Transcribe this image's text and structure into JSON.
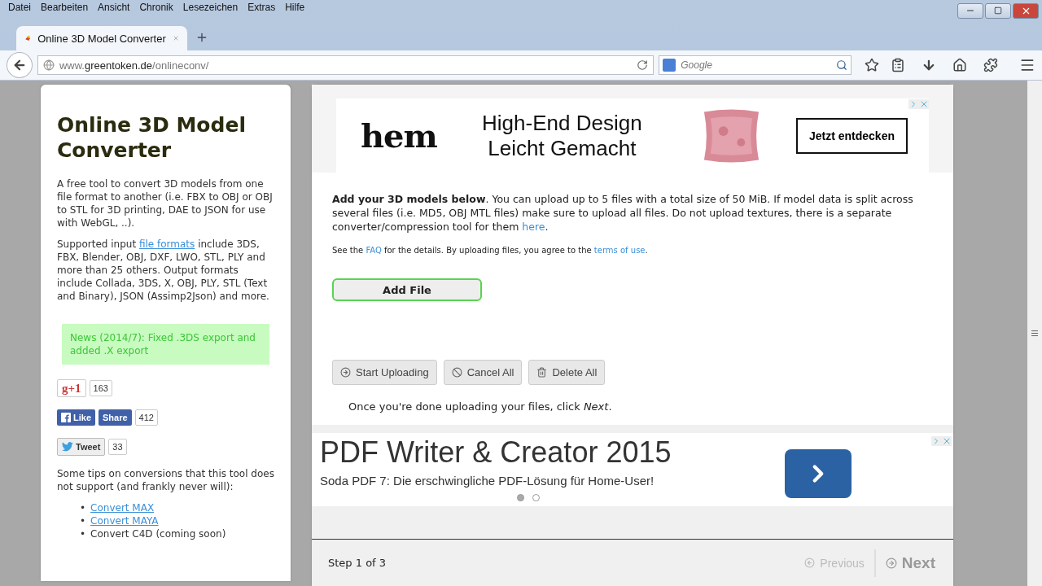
{
  "menu": [
    "Datei",
    "Bearbeiten",
    "Ansicht",
    "Chronik",
    "Lesezeichen",
    "Extras",
    "Hilfe"
  ],
  "tab": {
    "title": "Online 3D Model Converter",
    "selected": true
  },
  "address": {
    "prefix": "www.",
    "domain": "greentoken.de",
    "path": "/onlineconv/"
  },
  "search": {
    "placeholder": "Google"
  },
  "sidebar": {
    "title": "Online 3D Model Converter",
    "paragraphs": [
      [
        {
          "kind": "text",
          "text": "A free tool to convert 3D models from one file format to another (i.e. FBX to OBJ or OBJ to STL for 3D printing, DAE to JSON for use with WebGL, ..)."
        }
      ],
      [
        {
          "kind": "text",
          "text": "Supported input "
        },
        {
          "kind": "link",
          "text": "file formats"
        },
        {
          "kind": "text",
          "text": " include 3DS, FBX, Blender, OBJ, DXF, LWO, STL, PLY and more than 25 others. Output formats include Collada, 3DS, X, OBJ, PLY, STL (Text and Binary), JSON (Assimp2Json) and more."
        }
      ]
    ],
    "news": "News (2014/7): Fixed .3DS export and added .X export",
    "social": [
      {
        "kind": "gplus",
        "labels": [
          "g+1"
        ],
        "count": "163"
      },
      {
        "kind": "facebook",
        "labels": [
          "Like",
          "Share"
        ],
        "count": "412"
      },
      {
        "kind": "twitter",
        "labels": [
          "Tweet"
        ],
        "count": "33"
      }
    ],
    "tips_intro": "Some tips on conversions that this tool does not support (and frankly never will):",
    "tips": [
      {
        "kind": "link",
        "marker": "•",
        "text": "Convert MAX"
      },
      {
        "kind": "link",
        "marker": "•",
        "text": "Convert MAYA"
      },
      {
        "kind": "text",
        "marker": "•",
        "text": "Convert C4D (coming soon)"
      }
    ]
  },
  "ad_top": {
    "logo": "hem",
    "headline": [
      "High-End Design",
      "Leicht Gemacht"
    ],
    "button": "Jetzt entdecken"
  },
  "main": {
    "intro": [
      {
        "kind": "bold",
        "text": "Add your 3D models below"
      },
      {
        "kind": "text",
        "text": ". You can upload up to 5 files with a total size of 50 MiB. If model data is split across several files (i.e. MD5, OBJ MTL files) make sure to upload all files. Do not upload textures, there is a separate converter/compression tool for them "
      },
      {
        "kind": "link",
        "text": "here"
      },
      {
        "kind": "text",
        "text": "."
      }
    ],
    "note": [
      {
        "kind": "text",
        "text": "See the "
      },
      {
        "kind": "link",
        "text": "FAQ"
      },
      {
        "kind": "text",
        "text": " for the details. By uploading files, you agree to the "
      },
      {
        "kind": "link",
        "text": "terms of use"
      },
      {
        "kind": "text",
        "text": "."
      }
    ],
    "add_button": "Add File",
    "actions": [
      {
        "kind": "start",
        "label": "Start Uploading"
      },
      {
        "kind": "cancel",
        "label": "Cancel All"
      },
      {
        "kind": "delete",
        "label": "Delete All"
      }
    ],
    "done": [
      {
        "kind": "text",
        "text": "Once you're done uploading your files, click "
      },
      {
        "kind": "italic",
        "text": "Next"
      },
      {
        "kind": "text",
        "text": "."
      }
    ]
  },
  "ad_bottom": {
    "title": "PDF Writer & Creator 2015",
    "subtitle": "Soda PDF 7: Die erschwingliche PDF-Lösung für Home-User!",
    "dots": [
      {
        "selected": true
      },
      {
        "selected": false
      }
    ]
  },
  "footer": {
    "step": "Step 1 of 3",
    "previous": {
      "label": "Previous",
      "disabled": true
    },
    "next": {
      "label": "Next",
      "disabled": false
    }
  }
}
